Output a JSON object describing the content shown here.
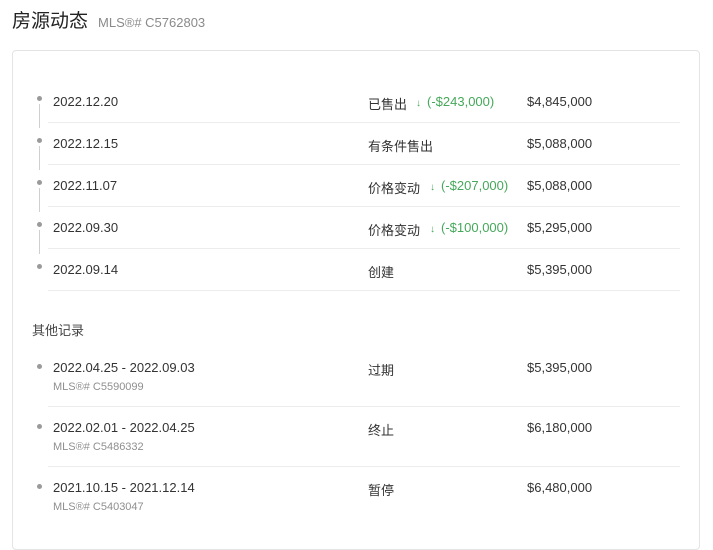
{
  "header": {
    "title": "房源动态",
    "mls": "MLS®# C5762803"
  },
  "history": [
    {
      "date": "2022.12.20",
      "status": "已售出",
      "arrow": "↓",
      "change": "(-$243,000)",
      "price": "$4,845,000"
    },
    {
      "date": "2022.12.15",
      "status": "有条件售出",
      "price": "$5,088,000"
    },
    {
      "date": "2022.11.07",
      "status": "价格变动",
      "arrow": "↓",
      "change": "(-$207,000)",
      "price": "$5,088,000"
    },
    {
      "date": "2022.09.30",
      "status": "价格变动",
      "arrow": "↓",
      "change": "(-$100,000)",
      "price": "$5,295,000"
    },
    {
      "date": "2022.09.14",
      "status": "创建",
      "price": "$5,395,000"
    }
  ],
  "other_records": {
    "title": "其他记录",
    "items": [
      {
        "dates": "2022.04.25 - 2022.09.03",
        "mls": "MLS®# C5590099",
        "status": "过期",
        "price": "$5,395,000"
      },
      {
        "dates": "2022.02.01 - 2022.04.25",
        "mls": "MLS®# C5486332",
        "status": "终止",
        "price": "$6,180,000"
      },
      {
        "dates": "2021.10.15 - 2021.12.14",
        "mls": "MLS®# C5403047",
        "status": "暂停",
        "price": "$6,480,000"
      }
    ]
  },
  "colors": {
    "decrease": "#45a85a",
    "bullet": "#9a9a9a"
  }
}
